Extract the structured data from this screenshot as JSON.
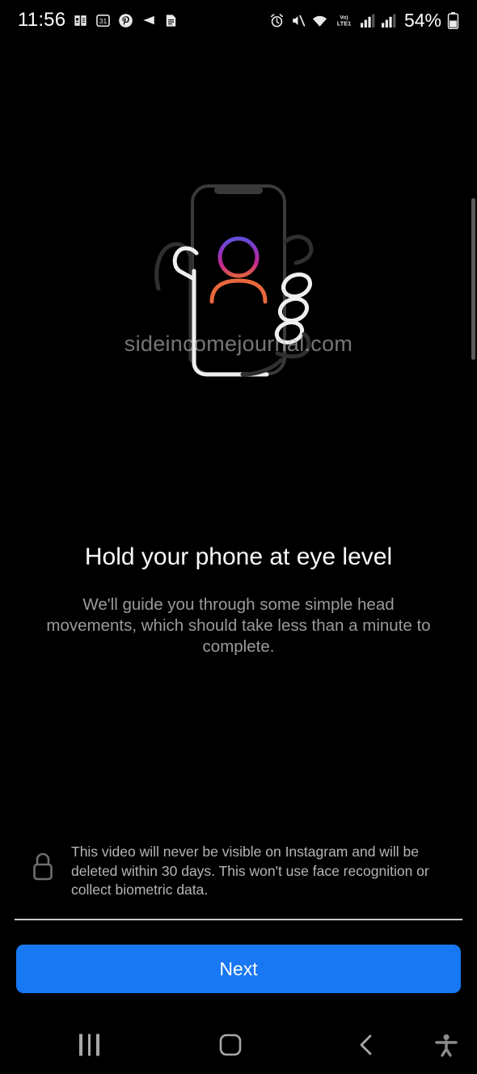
{
  "status_bar": {
    "time": "11:56",
    "battery_percent": "54%",
    "left_icons": [
      {
        "name": "dictionary-icon"
      },
      {
        "name": "calendar-icon",
        "label": "31"
      },
      {
        "name": "pinterest-icon"
      },
      {
        "name": "play-arrow-icon"
      },
      {
        "name": "document-icon"
      }
    ],
    "right_icons": [
      {
        "name": "alarm-icon"
      },
      {
        "name": "mute-icon"
      },
      {
        "name": "wifi-icon"
      },
      {
        "name": "volte-lte-icon",
        "label_top": "Vo)",
        "label_bottom": "LTE1"
      },
      {
        "name": "signal-bars-icon"
      },
      {
        "name": "signal-bars-secondary-icon"
      },
      {
        "name": "battery-icon"
      }
    ]
  },
  "illustration": {
    "name": "hold-phone-at-eye-level-illustration",
    "watermark": "sideincomejournal.com",
    "colors": {
      "dashed_line_left": "#7b3fe4",
      "dashed_line_right": "#c8298f",
      "avatar_head_top": "#7b3fe4",
      "avatar_head_bottom": "#c8298f",
      "avatar_shoulders": "#e8683c",
      "phone_outline": "#3a3a3c",
      "hand_outline": "#efefef"
    }
  },
  "main": {
    "title": "Hold your phone at eye level",
    "subtitle": "We'll guide you through some simple head movements, which should take less than a minute to complete."
  },
  "privacy_note": {
    "icon": "lock-icon",
    "text": "This video will never be visible on Instagram and will be deleted within 30 days. This won't use face recognition or collect biometric data."
  },
  "cta": {
    "next_label": "Next",
    "color": "#1877f2"
  },
  "nav_bar": {
    "recents": "recents-icon",
    "home": "home-icon",
    "back": "back-icon",
    "accessibility": "accessibility-icon"
  }
}
